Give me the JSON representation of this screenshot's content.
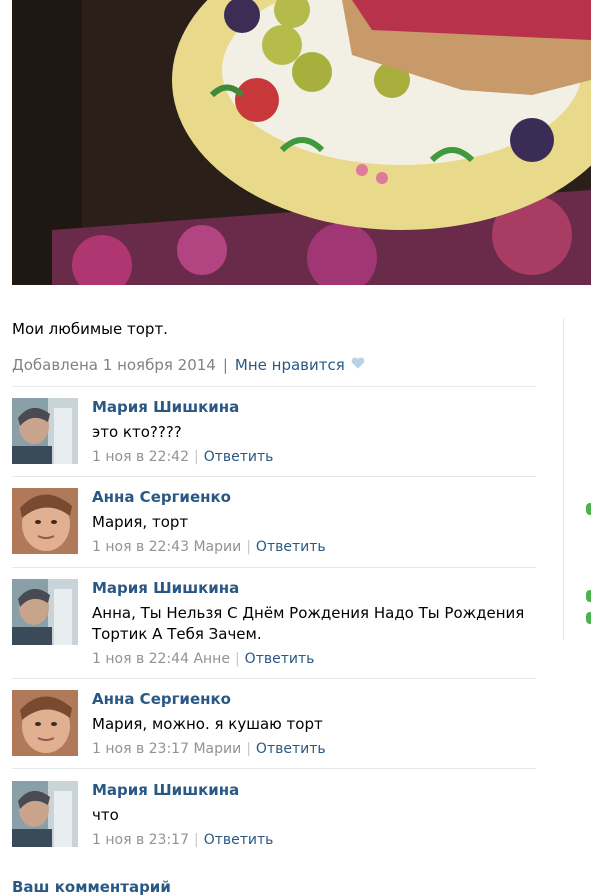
{
  "post": {
    "caption": "Мои любимые торт.",
    "added": "Добавлена 1 ноября 2014",
    "like_label": "Мне нравится"
  },
  "comments": [
    {
      "author": "Мария Шишкина",
      "text": "это кто????",
      "time": "1 ноя в 22:42",
      "to": "",
      "reply": "Ответить"
    },
    {
      "author": "Анна Сергиенко",
      "text": "Мария, торт",
      "time": "1 ноя в 22:43",
      "to": "Марии",
      "reply": "Ответить"
    },
    {
      "author": "Мария Шишкина",
      "text": "Анна, Ты Нельзя С Днём Рождения Надо Ты Рождения Тортик А Тебя Зачем.",
      "time": "1 ноя в 22:44",
      "to": "Анне",
      "reply": "Ответить"
    },
    {
      "author": "Анна Сергиенко",
      "text": "Мария, можно. я кушаю торт",
      "time": "1 ноя в 23:17",
      "to": "Марии",
      "reply": "Ответить"
    },
    {
      "author": "Мария Шишкина",
      "text": "что",
      "time": "1 ноя в 23:17",
      "to": "",
      "reply": "Ответить"
    }
  ],
  "your_comment_label": "Ваш комментарий",
  "colors": {
    "link": "#2a5885",
    "meta": "#939393",
    "divider": "#e7e8ec",
    "online_dot": "#4bb34b"
  }
}
